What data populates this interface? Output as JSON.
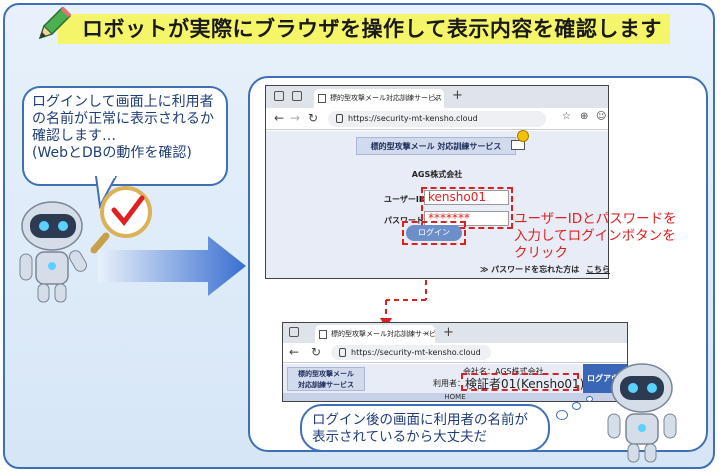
{
  "title": "ロボットが実際にブラウザを操作して表示内容を確認します",
  "speech_bubble": {
    "lines": [
      "ログインして画面上に利用者",
      "の名前が正常に表示されるか",
      "確認します…",
      "(WebとDBの動作を確認)"
    ]
  },
  "browser_login": {
    "tab_title": "標的型攻撃メール対応訓練サービス",
    "url": "https://security-mt-kensho.cloud",
    "site_logo": "標的型攻撃メール 対応訓練サービス",
    "company": "AGS株式会社",
    "user_id_label": "ユーザーID",
    "user_id_value": "kensho01",
    "password_label": "パスワード",
    "password_value": "*******",
    "login_button": "ログイン",
    "forgot_prefix": "≫",
    "forgot_label": "パスワードを忘れた方は",
    "forgot_link": "こちら"
  },
  "instruction_note": {
    "lines": [
      "ユーザーIDとパスワードを",
      "入力してログインボタンを",
      "クリック"
    ]
  },
  "browser_after": {
    "tab_title": "標的型攻撃メール対応訓練サービス",
    "url": "https://security-mt-kensho.cloud",
    "site_logo_line1": "標的型攻撃メール",
    "site_logo_line2": "対応訓練サービス",
    "company_line": "会社名：AGS株式会社",
    "user_label": "利用者：",
    "user_value": "検証者01(Kensho01)",
    "logout_tab": "ログアウト",
    "home_label": "HOME"
  },
  "thought_bubble": {
    "lines": [
      "ログイン後の画面に利用者の名前が",
      "表示されているから大丈夫だ"
    ]
  },
  "colors": {
    "frame_border": "#3f6fb5",
    "title_highlight": "#f5f56a",
    "alert_red": "#e02020",
    "bubble_text": "#1f3e7a",
    "arrow_blue": "#3a6fd0"
  },
  "icons": [
    "pencil-icon",
    "magnifier-icon",
    "checkmark-icon",
    "robot-icon",
    "mail-icon",
    "arrow-right-icon"
  ]
}
